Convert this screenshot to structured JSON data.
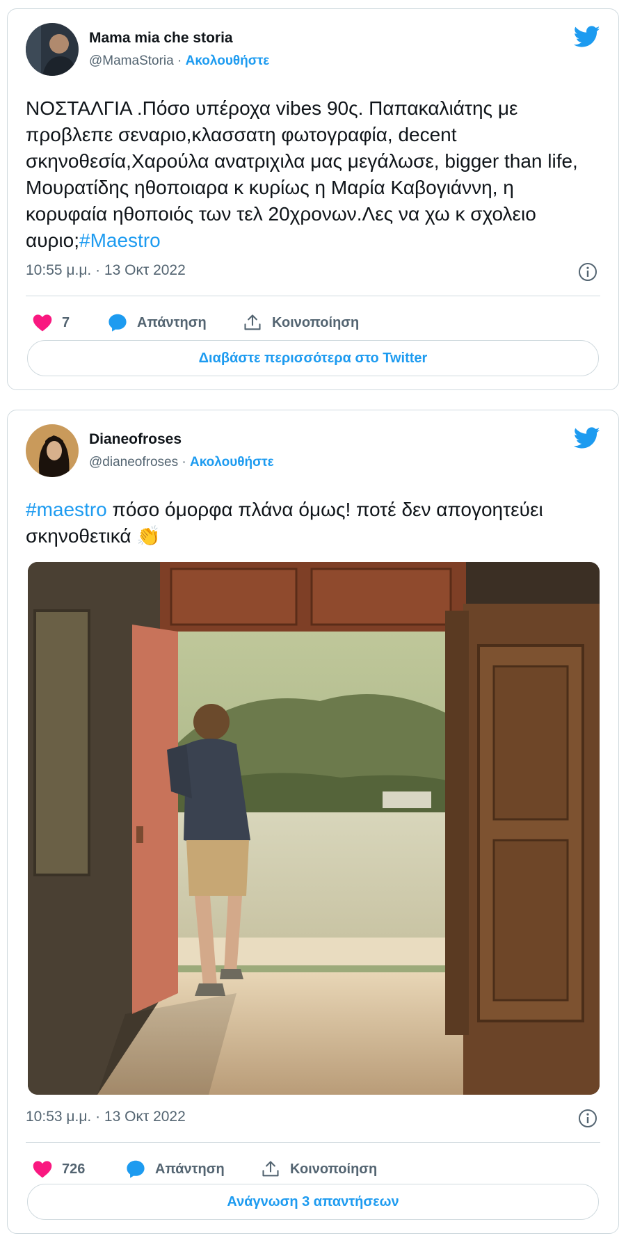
{
  "tweets": [
    {
      "author_name": "Mama mia che storia",
      "handle": "@MamaStoria",
      "separator": " · ",
      "follow_label": "Ακολουθήστε",
      "text": "ΝΟΣΤΑΛΓΙΑ .Πόσο υπέροχα vibes 90ς. Παπακαλιάτης με προβλεπε σεναριο,κλασσατη φωτογραφία, decent σκηνοθεσία,Χαρούλα ανατριχιλα μας μεγάλωσε, bigger than life, Μουρατίδης ηθοποιαρα κ κυρίως η Μαρία Καβογιάννη, η κορυφαία ηθοποιός των τελ 20χρονων.Λες να χω κ σχολειο αυριο;",
      "hashtag": "#Maestro",
      "timestamp": "10:55 μ.μ. · 13 Οκτ 2022",
      "likes": "7",
      "reply_label": "Απάντηση",
      "share_label": "Κοινοποίηση",
      "cta_label": "Διαβάστε περισσότερα στο Twitter"
    },
    {
      "author_name": "Dianeofroses",
      "handle": "@dianeofroses",
      "separator": " · ",
      "follow_label": "Ακολουθήστε",
      "hashtag": "#maestro",
      "text": " πόσο όμορφα πλάνα όμως! ποτέ δεν απογοητεύει σκηνοθετικά ",
      "emoji": "👏",
      "timestamp": "10:53 μ.μ. · 13 Οκτ 2022",
      "likes": "726",
      "reply_label": "Απάντηση",
      "share_label": "Κοινοποίηση",
      "cta_label": "Ανάγνωση 3 απαντήσεων"
    }
  ],
  "icons": {
    "bird": "twitter-bird-icon",
    "heart": "heart-icon",
    "reply": "reply-bubble-icon",
    "share": "share-icon",
    "info": "info-icon"
  },
  "colors": {
    "accent": "#1d9bf0",
    "heart": "#f91880",
    "secondary_text": "#536471",
    "border": "#cfd9de"
  }
}
